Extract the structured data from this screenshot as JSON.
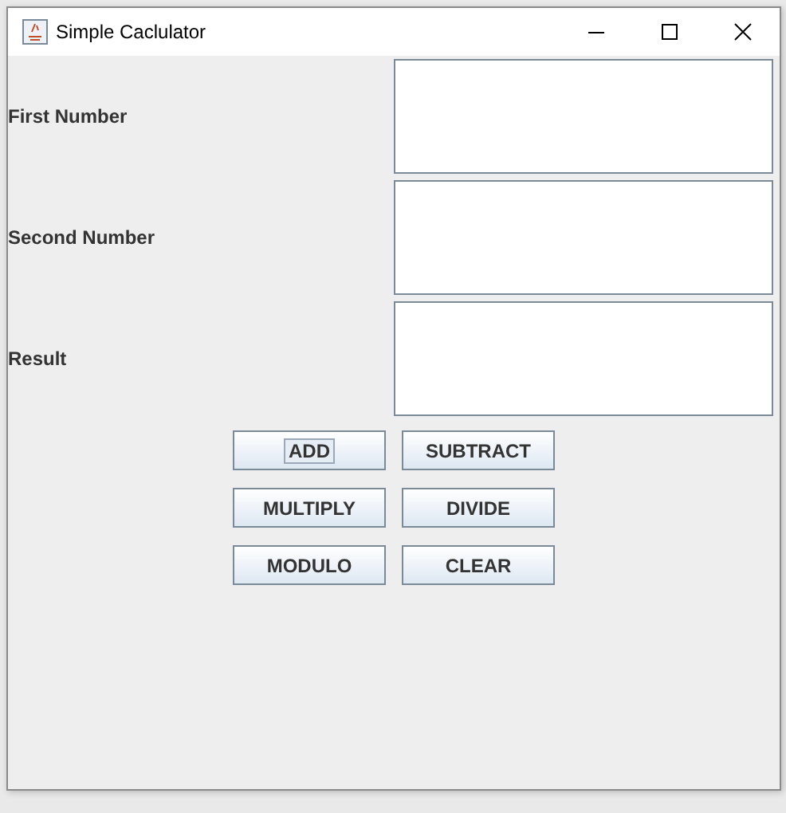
{
  "window": {
    "title": "Simple Caclulator"
  },
  "fields": [
    {
      "label": "First Number"
    },
    {
      "label": "Second Number"
    },
    {
      "label": "Result"
    }
  ],
  "buttons": [
    {
      "label": "ADD",
      "focused": true
    },
    {
      "label": "SUBTRACT",
      "focused": false
    },
    {
      "label": "MULTIPLY",
      "focused": false
    },
    {
      "label": "DIVIDE",
      "focused": false
    },
    {
      "label": "MODULO",
      "focused": false
    },
    {
      "label": "CLEAR",
      "focused": false
    }
  ]
}
